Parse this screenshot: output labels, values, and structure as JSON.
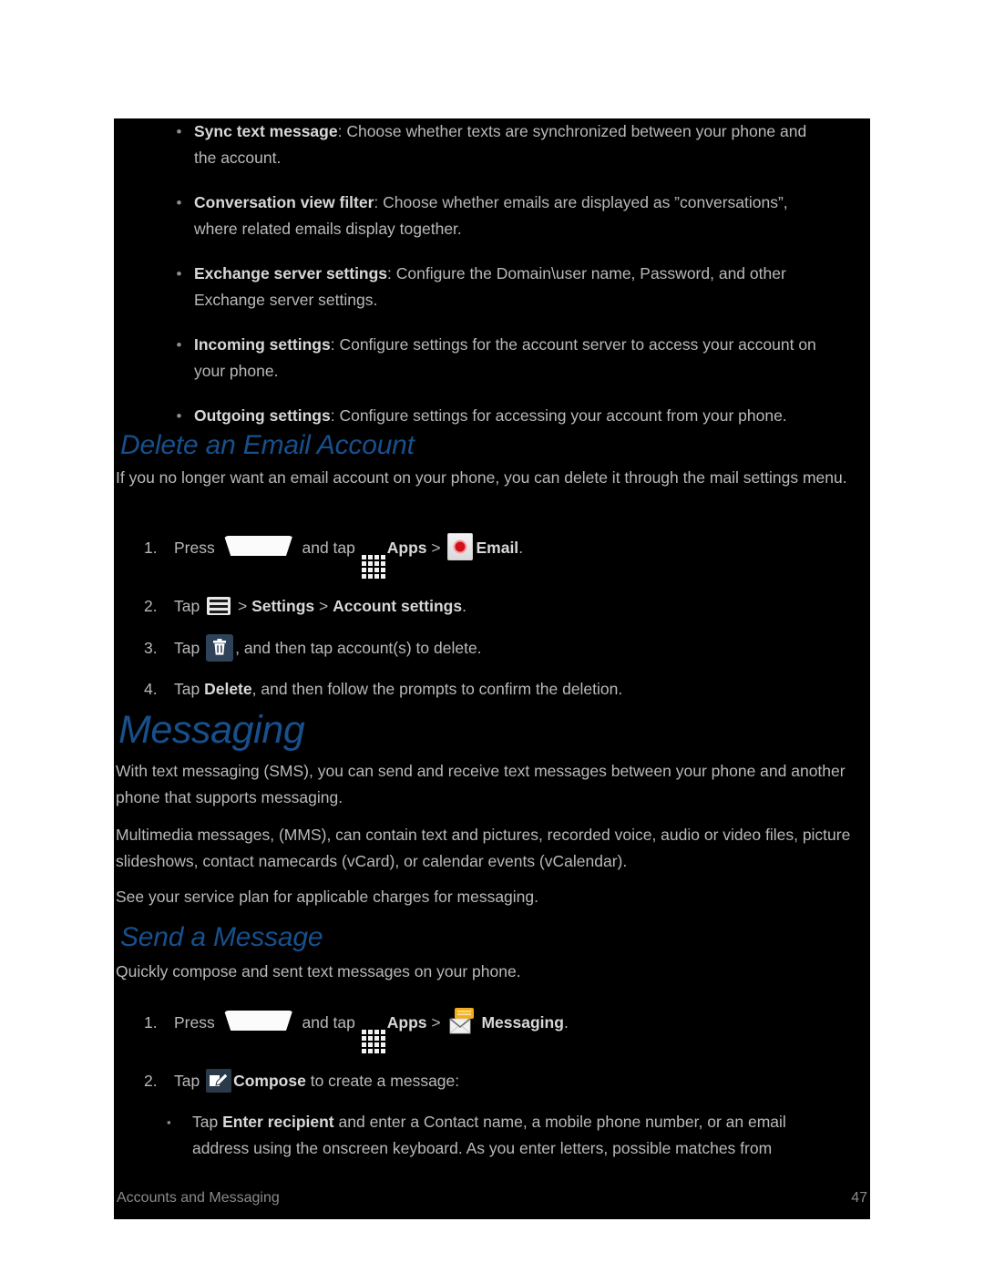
{
  "page": {
    "number": "47",
    "footer_section": "Accounts and Messaging",
    "accent_heading_color": "#17508c",
    "background_color": "#000000",
    "text_color": "#b9b9b9"
  },
  "settings_bullets": [
    {
      "term": "Sync text message",
      "rest": ": Choose whether texts are synchronized between your phone and the account."
    },
    {
      "term": "Conversation view filter",
      "rest": ": Choose whether emails are displayed as ”conversations”, where related emails display together."
    },
    {
      "term": "Exchange server settings",
      "rest": ": Configure the Domain\\user name, Password, and other Exchange server settings."
    },
    {
      "term": "Incoming settings",
      "rest": ": Configure settings for the account server to access your account on your phone."
    },
    {
      "term": "Outgoing settings",
      "rest": ": Configure settings for accessing your account from your phone."
    }
  ],
  "delete_email_account": {
    "heading": "Delete an Email Account",
    "intro": "If you no longer want an email account on your phone, you can delete it through the mail settings menu.",
    "steps": [
      {
        "num": "1.",
        "pre": "Press",
        "mid": "and tap",
        "apps_label": "Apps",
        "separator": ">",
        "app_label": "Email",
        "post": "."
      },
      {
        "num": "2.",
        "pre": "Tap",
        "separator": ">",
        "target1": "Settings",
        "separator2": ">",
        "target2": "Account settings",
        "post": "."
      },
      {
        "num": "3.",
        "pre": "Tap",
        "post": ", and then tap account(s) to delete."
      },
      {
        "num": "4.",
        "pre": "Tap",
        "bold": "Delete",
        "post": ", and then follow the prompts to confirm the deletion."
      }
    ]
  },
  "messaging": {
    "heading": "Messaging",
    "paragraphs": [
      "With text messaging (SMS), you can send and receive text messages between your phone and another phone that supports messaging.",
      "Multimedia messages, (MMS), can contain text and pictures, recorded voice, audio or video files, picture slideshows, contact namecards (vCard), or calendar events (vCalendar).",
      "See your service plan for applicable charges for messaging."
    ]
  },
  "send_a_message": {
    "heading": "Send a Message",
    "intro": "Quickly compose and sent text messages on your phone.",
    "steps": [
      {
        "num": "1.",
        "pre": "Press",
        "mid": "and tap",
        "apps_label": "Apps",
        "separator": ">",
        "app_label": "Messaging",
        "post": "."
      },
      {
        "num": "2.",
        "pre": "Tap",
        "bold": "Compose",
        "post": "to create a message:"
      }
    ],
    "sub_bullet": {
      "mark": "▪",
      "pre": "Tap",
      "bold": "Enter recipient",
      "rest": "and enter a Contact name, a mobile phone number, or an email address using the onscreen keyboard. As you enter letters, possible matches from"
    }
  },
  "icons": {
    "home_key": "home-key-icon",
    "apps": "apps-grid-icon",
    "email": "email-envelope-icon",
    "messaging": "messaging-envelope-icon",
    "menu": "menu-key-icon",
    "trash": "trash-icon",
    "compose": "compose-icon"
  }
}
